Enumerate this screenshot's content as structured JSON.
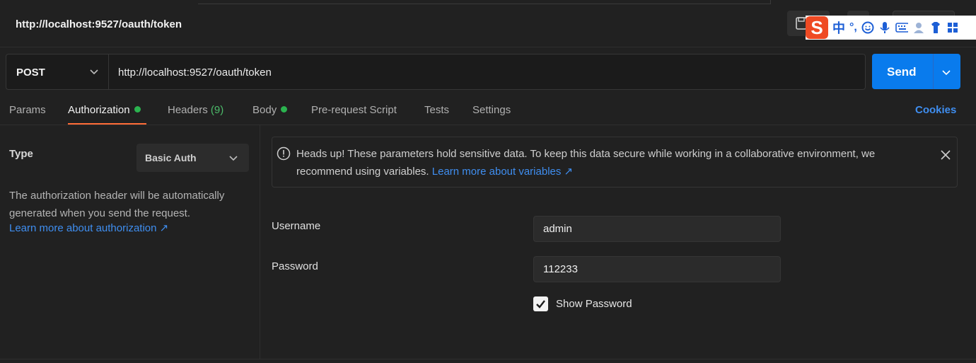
{
  "request_tab": {
    "title": "http://localhost:9527/oauth/token"
  },
  "ime": {
    "logo": "S",
    "mode": "中",
    "punct": "°,"
  },
  "url_bar": {
    "method": "POST",
    "url": "http://localhost:9527/oauth/token",
    "send_label": "Send"
  },
  "tabs": [
    {
      "label": "Params"
    },
    {
      "label": "Authorization",
      "active": true,
      "dot": true
    },
    {
      "label": "Headers",
      "count": "(9)"
    },
    {
      "label": "Body",
      "dot": true
    },
    {
      "label": "Pre-request Script"
    },
    {
      "label": "Tests"
    },
    {
      "label": "Settings"
    }
  ],
  "cookies_label": "Cookies",
  "auth": {
    "type_label": "Type",
    "type_value": "Basic Auth",
    "description": "The authorization header will be automatically generated when you send the request.",
    "learn_more": "Learn more about authorization ↗"
  },
  "alert": {
    "text": "Heads up! These parameters hold sensitive data. To keep this data secure while working in a collaborative environment, we recommend using variables.",
    "link": "Learn more about variables ↗"
  },
  "fields": {
    "username_label": "Username",
    "username_value": "admin",
    "password_label": "Password",
    "password_value": "112233",
    "show_password_label": "Show Password",
    "show_password_checked": true
  },
  "colors": {
    "accent": "#ff6c37",
    "send": "#097bed",
    "link": "#3f8ef0",
    "dot": "#2bb34f"
  }
}
